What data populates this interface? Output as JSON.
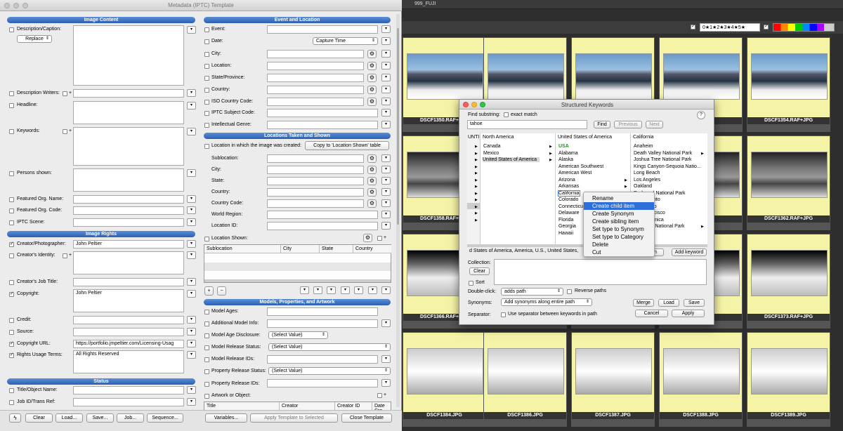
{
  "metadata_window": {
    "title": "Metadata (IPTC) Template",
    "sections": {
      "image_content": "Image Content",
      "event_location": "Event and Location",
      "locations_taken_shown": "Locations Taken and Shown",
      "image_rights": "Image Rights",
      "status": "Status",
      "models": "Models, Properties, and Artwork"
    },
    "left_labels": {
      "description": "Description/Caption:",
      "replace": "Replace",
      "desc_writers": "Description Writers:",
      "headline": "Headline:",
      "keywords": "Keywords:",
      "persons": "Persons shown:",
      "featured_org_name": "Featured Org. Name:",
      "featured_org_code": "Featured Org. Code:",
      "iptc_scene": "IPTC Scene:",
      "creator": "Creator/Photographer:",
      "creator_identity": "Creator's Identity:",
      "creator_job": "Creator's Job Title:",
      "copyright": "Copyright:",
      "credit": "Credit:",
      "source": "Source:",
      "copyright_url": "Copyright URL:",
      "usage_terms": "Rights Usage Terms:",
      "title": "Title/Object Name:",
      "job_id": "Job ID/Trans Ref:"
    },
    "left_values": {
      "creator": "John Peltier",
      "copyright": "John Peltier",
      "copyright_url": "https://portfolio.jmpeltier.com/Licensing-Usag",
      "usage_terms": "All Rights Reserved"
    },
    "right_labels": {
      "event": "Event:",
      "date": "Date:",
      "city": "City:",
      "location": "Location:",
      "state": "State/Province:",
      "country": "Country:",
      "iso": "ISO Country Code:",
      "iptc_subject": "IPTC Subject Code:",
      "genre": "Intellectual Genre:",
      "created_loc": "Location in which the image was created:",
      "copy_btn": "Copy to 'Location Shown' table",
      "sublocation": "Sublocation:",
      "city2": "City:",
      "state2": "State:",
      "country2": "Country:",
      "country_code2": "Country Code:",
      "world_region": "World Region:",
      "location_id": "Location ID:",
      "location_shown": "Location Shown:",
      "model_ages": "Model Ages:",
      "additional_model": "Additional Model Info:",
      "model_age_disc": "Model Age Disclosure:",
      "model_release_status": "Model Release Status:",
      "model_release_ids": "Model Release IDs:",
      "property_release_status": "Property Release Status:",
      "property_release_ids": "Property Release IDs:",
      "artwork": "Artwork or Object:"
    },
    "date_select": "Capture Time",
    "select_value": "(Select Value)",
    "loc_table_cols": [
      "Sublocation",
      "City",
      "State",
      "Country"
    ],
    "art_table_cols": [
      "Title",
      "Creator",
      "Creator ID",
      "Date Cre"
    ],
    "footer": {
      "clear": "Clear",
      "load": "Load...",
      "save": "Save...",
      "job": "Job...",
      "sequence": "Sequence...",
      "variables": "Variables...",
      "apply": "Apply Template to Selected",
      "close": "Close Template"
    }
  },
  "browser": {
    "folder": "999_FUJI",
    "rating_filter": "0★1★2★3★4★5★",
    "thumbnails": [
      {
        "name": "DSCF1350.RAF+JPG"
      },
      {
        "name": ""
      },
      {
        "name": ""
      },
      {
        "name": ""
      },
      {
        "name": "DSCF1354.RAF+JPG"
      },
      {
        "name": "DSCF1358.RAF+JPG"
      },
      {
        "name": ""
      },
      {
        "name": ""
      },
      {
        "name": ""
      },
      {
        "name": "DSCF1362.RAF+JPG"
      },
      {
        "name": "DSCF1366.RAF+JPG"
      },
      {
        "name": ""
      },
      {
        "name": ""
      },
      {
        "name": ""
      },
      {
        "name": "DSCF1373.RAF+JPG"
      },
      {
        "name": "DSCF1384.JPG"
      },
      {
        "name": "DSCF1386.JPG"
      },
      {
        "name": "DSCF1387.JPG"
      },
      {
        "name": "DSCF1388.JPG"
      },
      {
        "name": "DSCF1389.JPG"
      }
    ]
  },
  "keywords_dialog": {
    "title": "Structured Keywords",
    "find_label": "Find substring:",
    "exact_match": "exact match",
    "search_value": "tahoe",
    "find_btn": "Find",
    "previous_btn": "Previous",
    "next_btn": "Next",
    "help": "?",
    "col0_header": "UNTI",
    "col1_header": "North America",
    "col1_items": [
      "Canada",
      "Mexico",
      "United States of America"
    ],
    "col2_header": "United States of America",
    "col2_items": [
      "USA",
      "Alabama",
      "Alaska",
      "American Southwest",
      "American West",
      "Arizona",
      "Arkansas",
      "California",
      "Colorado",
      "Connecticut",
      "Delaware",
      "Florida",
      "Georgia",
      "Hawaii"
    ],
    "col3_header": "California",
    "col3_items": [
      "Anaheim",
      "Death Valley National Park",
      "Joshua Tree National Park",
      "Kings Canyon-Sequoia Natio...",
      "Long Beach",
      "Los Angeles",
      "Oakland",
      "Redwood National Park",
      "Sacramento",
      "San Diego",
      "San Francisco",
      "Santa Monica",
      "Yosemite National Park"
    ],
    "path_value": "d States of America, America, U.S., United States,",
    "add_path_btn": "th",
    "add_keyword_btn": "Add keyword",
    "collection_label": "Collection:",
    "clear_btn": "Clear",
    "sort_label": "Sort",
    "double_click_label": "Double-click:",
    "double_click_value": "adds path",
    "reverse_paths": "Reverse paths",
    "synonyms_label": "Synonyms:",
    "synonyms_value": "Add synonyms along entire path",
    "merge_btn": "Merge",
    "load_btn": "Load",
    "save_btn": "Save",
    "separator_label": "Separator:",
    "separator_check": "Use separator between keywords in path",
    "cancel_btn": "Cancel",
    "apply_btn": "Apply"
  },
  "context_menu": {
    "items": [
      "Rename",
      "Create child item",
      "Create Synonym",
      "Create sibling item",
      "Set type to Synonym",
      "Set type to Category",
      "Delete",
      "Cut"
    ],
    "highlighted": 1
  }
}
